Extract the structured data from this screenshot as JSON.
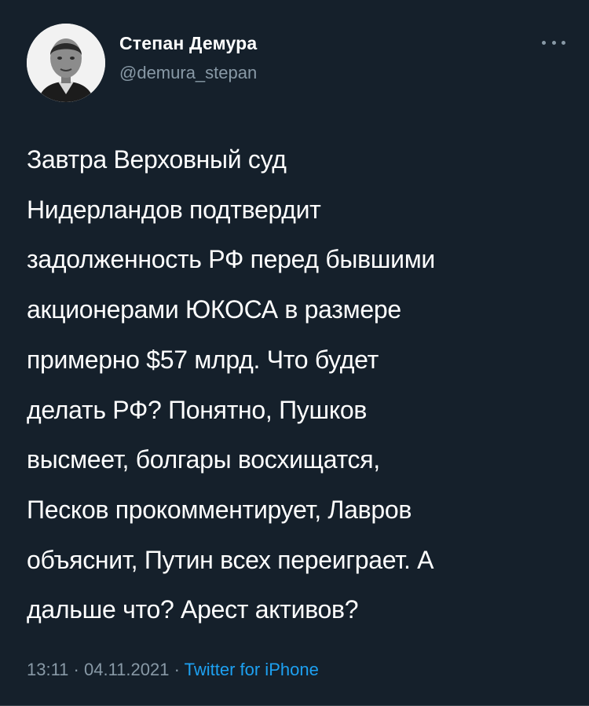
{
  "author": {
    "name": "Степан Демура",
    "handle": "@demura_stepan"
  },
  "tweet": {
    "text": "Завтра Верховный суд\nНидерландов подтвердит\nзадолженность РФ перед бывшими\nакционерами ЮКОСА в размере\nпримерно $57 млрд. Что будет\nделать РФ? Понятно, Пушков\nвысмеет, болгары восхищатся,\nПесков прокомментирует, Лавров\nобъяснит, Путин всех переиграет. А\nдальше что? Арест активов?",
    "time": "13:11",
    "separator": " · ",
    "date": "04.11.2021",
    "source": "Twitter for iPhone"
  },
  "colors": {
    "background": "#15202b",
    "text": "#ffffff",
    "secondary": "#8899a6",
    "link": "#1da1f2"
  },
  "icons": {
    "more": "more-horizontal-icon"
  }
}
